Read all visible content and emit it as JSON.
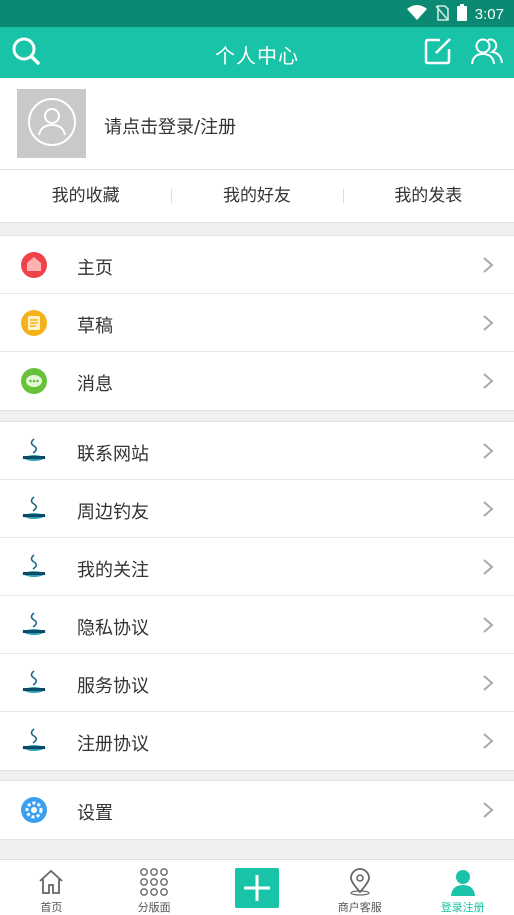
{
  "status_bar": {
    "time": "3:07"
  },
  "app_bar": {
    "title": "个人中心"
  },
  "profile": {
    "login_text": "请点击登录/注册"
  },
  "quick_links": [
    {
      "label": "我的收藏"
    },
    {
      "label": "我的好友"
    },
    {
      "label": "我的发表"
    }
  ],
  "group1": [
    {
      "label": "主页",
      "icon": "home-icon"
    },
    {
      "label": "草稿",
      "icon": "draft-icon"
    },
    {
      "label": "消息",
      "icon": "message-icon"
    }
  ],
  "group2": [
    {
      "label": "联系网站",
      "icon": "fish-logo-icon"
    },
    {
      "label": "周边钓友",
      "icon": "fish-logo-icon"
    },
    {
      "label": "我的关注",
      "icon": "fish-logo-icon"
    },
    {
      "label": "隐私协议",
      "icon": "fish-logo-icon"
    },
    {
      "label": "服务协议",
      "icon": "fish-logo-icon"
    },
    {
      "label": "注册协议",
      "icon": "fish-logo-icon"
    }
  ],
  "group3": [
    {
      "label": "设置",
      "icon": "settings-icon"
    }
  ],
  "tab_bar": [
    {
      "label": "首页",
      "icon": "home-outline-icon"
    },
    {
      "label": "分版面",
      "icon": "grid-dots-icon"
    },
    {
      "label": "",
      "icon": "plus-icon"
    },
    {
      "label": "商户客服",
      "icon": "location-pin-icon"
    },
    {
      "label": "登录注册",
      "icon": "user-icon",
      "active": true
    }
  ],
  "colors": {
    "accent": "#18c3a7",
    "status_bar": "#0a8a72"
  }
}
